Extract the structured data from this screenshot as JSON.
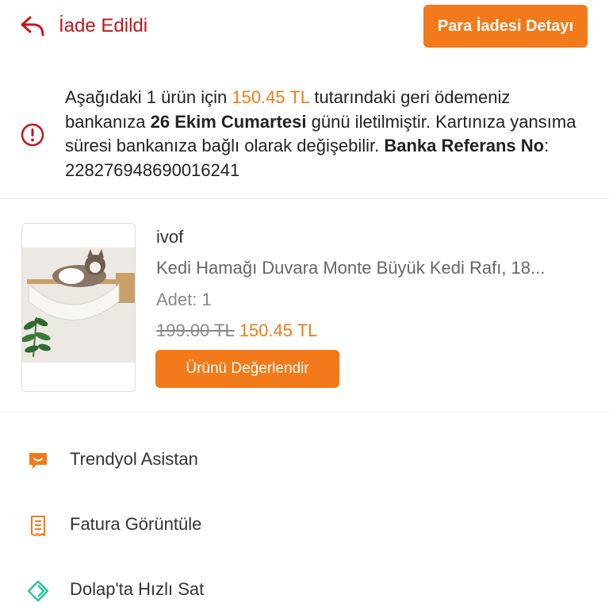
{
  "header": {
    "status_title": "İade Edildi",
    "refund_button_label": "Para İadesi Detayı"
  },
  "notice": {
    "part1": "Aşağıdaki 1 ürün için ",
    "amount": "150.45 TL",
    "part2": " tutarındaki geri ödemeniz bankanıza ",
    "date": "26 Ekim Cumartesi",
    "part3": " günü iletilmiştir. Kartınıza yansıma süresi bankanıza bağlı olarak değişebilir. ",
    "ref_label": "Banka Referans No",
    "ref_separator": ": ",
    "ref_number": "228276948690016241"
  },
  "product": {
    "seller": "ivof",
    "name": "Kedi Hamağı Duvara Monte Büyük Kedi Rafı, 18...",
    "qty_label": "Adet:",
    "qty_value": "1",
    "old_price": "199.00 TL",
    "new_price": "150.45 TL",
    "rate_button_label": "Ürünü Değerlendir"
  },
  "actions": [
    {
      "label": "Trendyol Asistan",
      "icon": "chat-icon"
    },
    {
      "label": "Fatura Görüntüle",
      "icon": "invoice-icon"
    },
    {
      "label": "Dolap'ta Hızlı Sat",
      "icon": "tag-icon"
    }
  ],
  "colors": {
    "accent": "#f27a1a",
    "status_red": "#c4161c",
    "dolap_green": "#2bc5a0"
  }
}
